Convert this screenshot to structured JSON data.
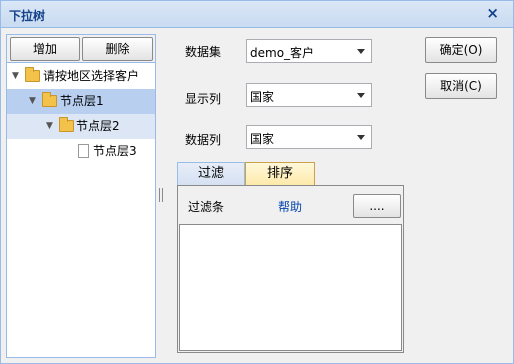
{
  "window": {
    "title": "下拉树",
    "close_glyph": "×"
  },
  "tree_toolbar": {
    "add_label": "增加",
    "delete_label": "删除"
  },
  "tree": {
    "root": "请按地区选择客户",
    "level1": "节点层1",
    "level2": "节点层2",
    "level3": "节点层3"
  },
  "form": {
    "dataset_label": "数据集",
    "dataset_value": "demo_客户",
    "display_label": "显示列",
    "display_value": "国家",
    "data_label": "数据列",
    "data_value": "国家"
  },
  "tabs": {
    "filter": "过滤",
    "sort": "排序"
  },
  "filter": {
    "label": "过滤条",
    "help": "帮助",
    "more_button": "...."
  },
  "actions": {
    "ok": "确定(O)",
    "cancel": "取消(C)"
  }
}
